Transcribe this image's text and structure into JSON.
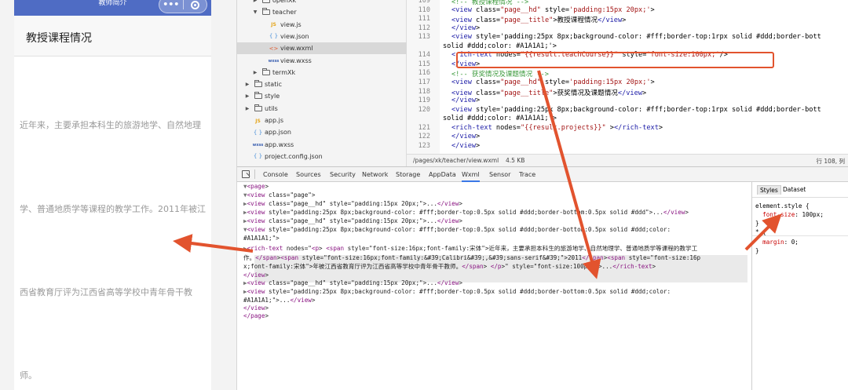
{
  "colors": {
    "accent_red": "#e2532e",
    "nav_blue": "#4f6cc4"
  },
  "phone": {
    "nav_title": "教师简介",
    "capsule_more": "•••",
    "section_title": "教授课程情况",
    "text_lines": [
      "近年来，主要承担本科生的旅游地学、自然地理",
      "学、普通地质学等课程的教学工作。2011年被江",
      "西省教育厅评为江西省高等学校中青年骨干教",
      "师。"
    ]
  },
  "filetree": {
    "items": [
      {
        "name": "openXk",
        "type": "folder",
        "indent": 1
      },
      {
        "name": "teacher",
        "type": "folder-open",
        "indent": 1
      },
      {
        "name": "view.js",
        "type": "js",
        "indent": 2
      },
      {
        "name": "view.json",
        "type": "json",
        "indent": 2
      },
      {
        "name": "view.wxml",
        "type": "wxml",
        "indent": 2,
        "selected": true
      },
      {
        "name": "view.wxss",
        "type": "wxss",
        "indent": 2
      },
      {
        "name": "termXk",
        "type": "folder",
        "indent": 1
      },
      {
        "name": "static",
        "type": "folder",
        "indent": 0
      },
      {
        "name": "style",
        "type": "folder",
        "indent": 0
      },
      {
        "name": "utils",
        "type": "folder",
        "indent": 0
      },
      {
        "name": "app.js",
        "type": "js",
        "indent": 0
      },
      {
        "name": "app.json",
        "type": "json",
        "indent": 0
      },
      {
        "name": "app.wxss",
        "type": "wxss",
        "indent": 0
      },
      {
        "name": "project.config.json",
        "type": "json",
        "indent": 0
      }
    ]
  },
  "editor": {
    "line_numbers": [
      "109",
      "110",
      "111",
      "112",
      "113",
      "",
      "114",
      "115",
      "116",
      "117",
      "118",
      "119",
      "120",
      "",
      "121",
      "122",
      "123"
    ],
    "lines": [
      "<!-- 教授课程情况 -->",
      "<view class=\"page__hd\" style='padding:15px 20px;'>",
      "  <view class=\"page__title\">教授课程情况</view>",
      "</view>",
      "<view style='padding:25px 8px;background-color: #fff;border-top:1rpx solid #ddd;border-bott",
      "solid #ddd;color: #A1A1A1;'>",
      "  <rich-text nodes=\"{{result.teachCourse}}\" style='font-size:100px;'/>",
      "</view>",
      "<!-- 获奖情况及课题情况 -->",
      "<view class=\"page__hd\" style='padding:15px 20px;'>",
      "  <view class=\"page__title\">获奖情况及课题情况</view>",
      "</view>",
      "<view style='padding:25px 8px;background-color: #fff;border-top:1rpx solid #ddd;border-bott",
      "solid #ddd;color: #A1A1A1;'>",
      "  <rich-text nodes=\"{{result.projects}}\" ></rich-text>",
      "</view>",
      "</view>"
    ],
    "status_path": "/pages/xk/teacher/view.wxml",
    "status_size": "4.5 KB",
    "status_pos": "行 108, 列"
  },
  "devtools": {
    "tabs": [
      "Console",
      "Sources",
      "Security",
      "Network",
      "Storage",
      "AppData",
      "Wxml",
      "Sensor",
      "Trace"
    ],
    "active_tab": "Wxml",
    "dom_lines": [
      "▼<page>",
      "  ▼<view class=\"page\">",
      "    ▶<view class=\"page__hd\" style=\"padding:15px 20px;\">...</view>",
      "    ▶<view style=\"padding:25px 8px;background-color: #fff;border-top:0.5px solid #ddd;border-bottom:0.5px solid #ddd\">...</view>",
      "    ▶<view class=\"page__hd\" style=\"padding:15px 20px;\">...</view>",
      "    ▼<view style=\"padding:25px 8px;background-color: #fff;border-top:0.5px solid #ddd;border-bottom:0.5px solid #ddd;color:",
      "    #A1A1A1;\">",
      "      ▶<rich-text nodes=\"<p> <span style=\"font-size:16px;font-family:宋体\">近年来，主要承担本科生的旅游地学、自然地理学、普通地质学等课程的教学工",
      "      作。</span><span style=\"font-size:16px;font-family:&#39;Calibri&#39;,&#39;sans-serif&#39;\">2011</span><span style=\"font-size:16p",
      "      x;font-family:宋体\">年被江西省教育厅评为江西省高等学校中青年骨干教师。</span> </p>\" style=\"font-size:100px;\">...</rich-text>",
      "    </view>",
      "    ▶<view class=\"page__hd\" style=\"padding:15px 20px;\">...</view>",
      "    ▶<view style=\"padding:25px 8px;background-color: #fff;border-top:0.5px solid #ddd;border-bottom:0.5px solid #ddd;color:",
      "    #A1A1A1;\">...</view>",
      "  </view>",
      "</page>"
    ],
    "styles_tab": "Styles",
    "dataset_tab": "Dataset",
    "style_lines": [
      "element.style {",
      "  font-size: 100px;",
      "}",
      "* {",
      "  margin: 0;",
      "}"
    ]
  }
}
